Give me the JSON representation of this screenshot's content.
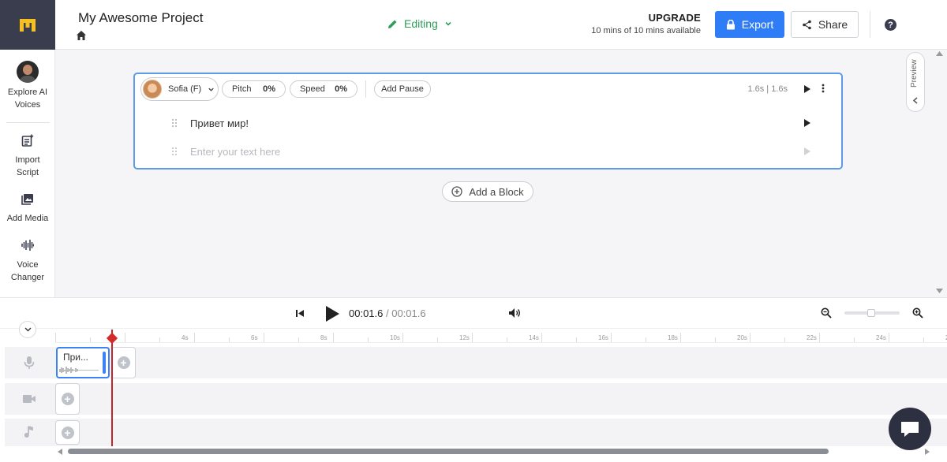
{
  "header": {
    "project_title": "My Awesome Project",
    "mode_label": "Editing",
    "upgrade_label": "UPGRADE",
    "minutes_available": "10 mins of 10 mins available",
    "export_label": "Export",
    "share_label": "Share",
    "help_label": "?",
    "accent_color": "#2f7df6",
    "editing_color": "#2e9e5b"
  },
  "sidebar": {
    "items": [
      {
        "label_line1": "Explore AI",
        "label_line2": "Voices",
        "icon": "voice-avatar-icon"
      },
      {
        "label_line1": "Import",
        "label_line2": "Script",
        "icon": "import-script-icon"
      },
      {
        "label_line1": "Add Media",
        "label_line2": "",
        "icon": "media-icon"
      },
      {
        "label_line1": "Voice",
        "label_line2": "Changer",
        "icon": "waveform-icon"
      }
    ]
  },
  "block": {
    "voice_name": "Sofia (F)",
    "pitch_label": "Pitch",
    "pitch_value": "0%",
    "speed_label": "Speed",
    "speed_value": "0%",
    "add_pause_label": "Add Pause",
    "duration": "1.6s | 1.6s",
    "rows": [
      {
        "text": "Привет мир!"
      },
      {
        "placeholder": "Enter your text here"
      }
    ]
  },
  "add_block_label": "Add a Block",
  "preview_label": "Preview",
  "timeline": {
    "current_time": "00:01.6",
    "separator": " / ",
    "total_time": "00:01.6",
    "zoom_level": 0.5,
    "ruler_labels": [
      "4s",
      "6s",
      "8s",
      "10s",
      "12s",
      "14s",
      "16s",
      "18s",
      "20s",
      "22s",
      "24s",
      "2"
    ],
    "clip_label": "При...",
    "tracks": [
      "voice-track",
      "video-track",
      "music-track"
    ]
  }
}
